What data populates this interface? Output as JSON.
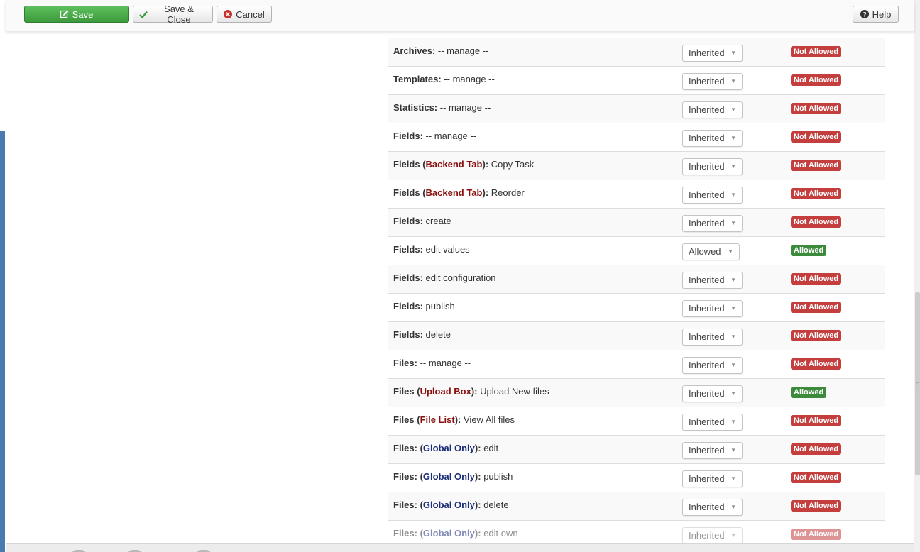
{
  "toolbar": {
    "save_label": "Save",
    "save_close_label": "Save & Close",
    "cancel_label": "Cancel",
    "help_label": "Help"
  },
  "colors": {
    "not_allowed": "#c43e3e",
    "allowed": "#3c8b3c",
    "save_green": "#46a546"
  },
  "rows": [
    {
      "prefix": "",
      "tag": "",
      "tag_color": "",
      "suffix": "",
      "setting": "Inherited",
      "status": "Not Allowed",
      "allowed": false,
      "partial": true
    },
    {
      "prefix": "Archives:",
      "tag": "",
      "tag_color": "",
      "suffix": "-- manage --",
      "setting": "Inherited",
      "status": "Not Allowed",
      "allowed": false
    },
    {
      "prefix": "Templates:",
      "tag": "",
      "tag_color": "",
      "suffix": "-- manage --",
      "setting": "Inherited",
      "status": "Not Allowed",
      "allowed": false
    },
    {
      "prefix": "Statistics:",
      "tag": "",
      "tag_color": "",
      "suffix": "-- manage --",
      "setting": "Inherited",
      "status": "Not Allowed",
      "allowed": false
    },
    {
      "prefix": "Fields:",
      "tag": "",
      "tag_color": "",
      "suffix": "-- manage --",
      "setting": "Inherited",
      "status": "Not Allowed",
      "allowed": false
    },
    {
      "prefix": "Fields",
      "tag": "Backend Tab",
      "tag_color": "red",
      "suffix": "Copy Task",
      "setting": "Inherited",
      "status": "Not Allowed",
      "allowed": false
    },
    {
      "prefix": "Fields",
      "tag": "Backend Tab",
      "tag_color": "red",
      "suffix": "Reorder",
      "setting": "Inherited",
      "status": "Not Allowed",
      "allowed": false
    },
    {
      "prefix": "Fields:",
      "tag": "",
      "tag_color": "",
      "suffix": "create",
      "setting": "Inherited",
      "status": "Not Allowed",
      "allowed": false
    },
    {
      "prefix": "Fields:",
      "tag": "",
      "tag_color": "",
      "suffix": "edit values",
      "setting": "Allowed",
      "status": "Allowed",
      "allowed": true
    },
    {
      "prefix": "Fields:",
      "tag": "",
      "tag_color": "",
      "suffix": "edit configuration",
      "setting": "Inherited",
      "status": "Not Allowed",
      "allowed": false
    },
    {
      "prefix": "Fields:",
      "tag": "",
      "tag_color": "",
      "suffix": "publish",
      "setting": "Inherited",
      "status": "Not Allowed",
      "allowed": false
    },
    {
      "prefix": "Fields:",
      "tag": "",
      "tag_color": "",
      "suffix": "delete",
      "setting": "Inherited",
      "status": "Not Allowed",
      "allowed": false
    },
    {
      "prefix": "Files:",
      "tag": "",
      "tag_color": "",
      "suffix": "-- manage --",
      "setting": "Inherited",
      "status": "Not Allowed",
      "allowed": false
    },
    {
      "prefix": "Files",
      "tag": "Upload Box",
      "tag_color": "red",
      "suffix": "Upload New files",
      "setting": "Inherited",
      "status": "Allowed",
      "allowed": true
    },
    {
      "prefix": "Files",
      "tag": "File List",
      "tag_color": "red",
      "suffix": "View All files",
      "setting": "Inherited",
      "status": "Not Allowed",
      "allowed": false
    },
    {
      "prefix": "Files:",
      "tag": "Global Only",
      "tag_color": "blue",
      "suffix": "edit",
      "setting": "Inherited",
      "status": "Not Allowed",
      "allowed": false
    },
    {
      "prefix": "Files:",
      "tag": "Global Only",
      "tag_color": "blue",
      "suffix": "publish",
      "setting": "Inherited",
      "status": "Not Allowed",
      "allowed": false
    },
    {
      "prefix": "Files:",
      "tag": "Global Only",
      "tag_color": "blue",
      "suffix": "delete",
      "setting": "Inherited",
      "status": "Not Allowed",
      "allowed": false
    },
    {
      "prefix": "Files:",
      "tag": "Global Only",
      "tag_color": "blue",
      "suffix": "edit own",
      "setting": "Inherited",
      "status": "Not Allowed",
      "allowed": false,
      "faded": true
    }
  ]
}
